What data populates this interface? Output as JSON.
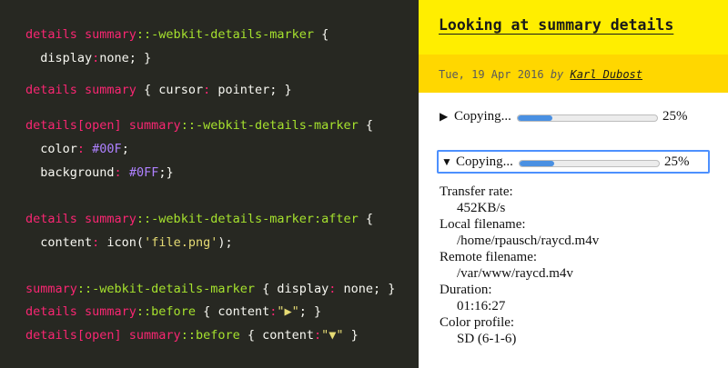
{
  "code": {
    "lines": [
      [
        {
          "t": "details summary",
          "c": "t-sel"
        },
        {
          "t": "::-webkit-details-marker",
          "c": "t-pseudo"
        },
        {
          "t": " {",
          "c": "t-punc"
        }
      ],
      [
        {
          "t": "  display",
          "c": "t-prop"
        },
        {
          "t": ":",
          "c": "t-colon"
        },
        {
          "t": "none; }",
          "c": "t-punc"
        }
      ],
      [
        {
          "t": "details summary",
          "c": "t-sel"
        },
        {
          "t": " { cursor",
          "c": "t-prop"
        },
        {
          "t": ":",
          "c": "t-colon"
        },
        {
          "t": " pointer; }",
          "c": "t-punc"
        }
      ],
      [
        {
          "t": "details[open] summary",
          "c": "t-sel"
        },
        {
          "t": "::-webkit-details-marker",
          "c": "t-pseudo"
        },
        {
          "t": " {",
          "c": "t-punc"
        }
      ],
      [
        {
          "t": "  color",
          "c": "t-prop"
        },
        {
          "t": ":",
          "c": "t-colon"
        },
        {
          "t": " #00F",
          "c": "t-num"
        },
        {
          "t": ";",
          "c": "t-punc"
        }
      ],
      [
        {
          "t": "  background",
          "c": "t-prop"
        },
        {
          "t": ":",
          "c": "t-colon"
        },
        {
          "t": " #0FF",
          "c": "t-num"
        },
        {
          "t": ";}",
          "c": "t-punc"
        }
      ],
      [
        {
          "t": "details summary",
          "c": "t-sel"
        },
        {
          "t": "::-webkit-details-marker:after",
          "c": "t-pseudo"
        },
        {
          "t": " {",
          "c": "t-punc"
        }
      ],
      [
        {
          "t": "  content",
          "c": "t-prop"
        },
        {
          "t": ":",
          "c": "t-colon"
        },
        {
          "t": " icon(",
          "c": "t-punc"
        },
        {
          "t": "'file.png'",
          "c": "t-str"
        },
        {
          "t": ");",
          "c": "t-punc"
        }
      ],
      [
        {
          "t": "summary",
          "c": "t-sel"
        },
        {
          "t": "::-webkit-details-marker",
          "c": "t-pseudo"
        },
        {
          "t": " { display",
          "c": "t-prop"
        },
        {
          "t": ":",
          "c": "t-colon"
        },
        {
          "t": " none; }",
          "c": "t-punc"
        }
      ],
      [
        {
          "t": "details summary",
          "c": "t-sel"
        },
        {
          "t": "::before",
          "c": "t-pseudo"
        },
        {
          "t": " { content",
          "c": "t-prop"
        },
        {
          "t": ":",
          "c": "t-colon"
        },
        {
          "t": "\"▶\"",
          "c": "t-str"
        },
        {
          "t": "; }",
          "c": "t-punc"
        }
      ],
      [
        {
          "t": "details[open] summary",
          "c": "t-sel"
        },
        {
          "t": "::before",
          "c": "t-pseudo"
        },
        {
          "t": " { content",
          "c": "t-prop"
        },
        {
          "t": ":",
          "c": "t-colon"
        },
        {
          "t": "\"▼\"",
          "c": "t-str"
        },
        {
          "t": " }",
          "c": "t-punc"
        }
      ]
    ]
  },
  "article": {
    "title": "Looking at summary details",
    "date": "Tue, 19 Apr 2016",
    "by": "by",
    "author": "Karl Dubost"
  },
  "details": [
    {
      "triangle": "▶",
      "label": "Copying...",
      "progress": 0.25,
      "percent": "25%",
      "open": false
    },
    {
      "triangle": "▼",
      "label": "Copying...",
      "progress": 0.25,
      "percent": "25%",
      "open": true
    }
  ],
  "info": [
    {
      "label": "Transfer rate:",
      "value": "452KB/s"
    },
    {
      "label": "Local filename:",
      "value": "/home/rpausch/raycd.m4v"
    },
    {
      "label": "Remote filename:",
      "value": "/var/www/raycd.m4v"
    },
    {
      "label": "Duration:",
      "value": "01:16:27"
    },
    {
      "label": "Color profile:",
      "value": "SD (6-1-6)"
    }
  ],
  "colors": {
    "code_bg": "#272822",
    "header_yellow": "#ffee00",
    "meta_yellow": "#ffd700",
    "progress_blue": "#4a90e2",
    "focus_blue": "#4d90fe"
  }
}
